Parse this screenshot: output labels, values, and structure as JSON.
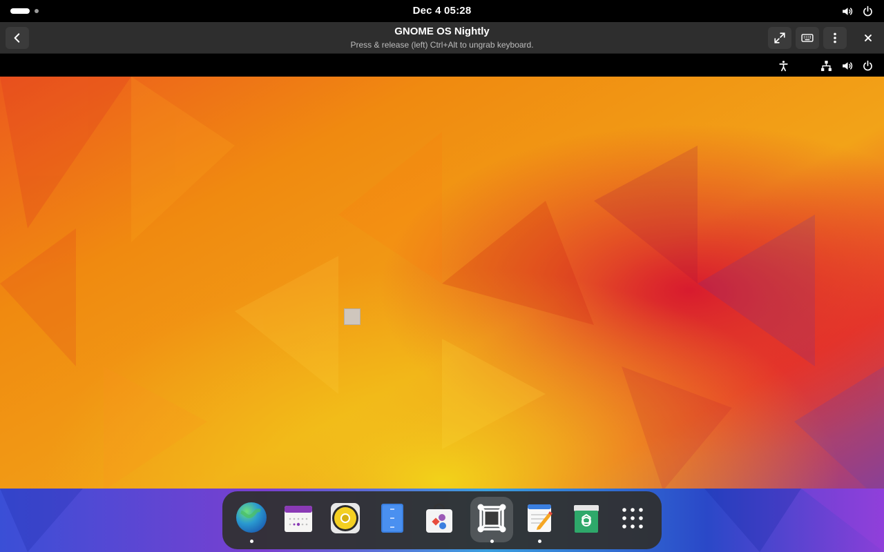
{
  "host": {
    "clock": "Dec 4  05:28",
    "tray_icons": [
      "volume-icon",
      "power-icon"
    ]
  },
  "viewer": {
    "title": "GNOME OS Nightly",
    "subtitle": "Press & release (left) Ctrl+Alt to ungrab keyboard.",
    "buttons": [
      "back-button",
      "fullscreen-button",
      "keyboard-button",
      "menu-button",
      "close-button"
    ]
  },
  "guest": {
    "tray_icons": [
      "accessibility-icon",
      "network-icon",
      "volume-icon",
      "power-icon"
    ],
    "dash": {
      "apps": [
        {
          "name": "Web Browser",
          "icon": "web-browser-icon",
          "running": true
        },
        {
          "name": "Calendar",
          "icon": "calendar-icon",
          "running": false
        },
        {
          "name": "Rhythmbox",
          "icon": "music-player-icon",
          "running": false
        },
        {
          "name": "Files",
          "icon": "files-icon",
          "running": false
        },
        {
          "name": "Software",
          "icon": "software-store-icon",
          "running": false
        },
        {
          "name": "Boxes",
          "icon": "boxes-icon",
          "running": true,
          "active": true
        },
        {
          "name": "Text Editor",
          "icon": "text-editor-icon",
          "running": true
        },
        {
          "name": "Trash",
          "icon": "trash-icon",
          "running": false
        },
        {
          "name": "Show Apps",
          "icon": "show-apps-icon",
          "running": false
        }
      ]
    }
  },
  "colors": {
    "wallpaper_orange": "#f08a10",
    "wallpaper_red": "#e0262a",
    "wallpaper_yellow": "#f2c21a",
    "wallpaper_purple": "#7a3fb0",
    "dash_bg": "#303030"
  }
}
